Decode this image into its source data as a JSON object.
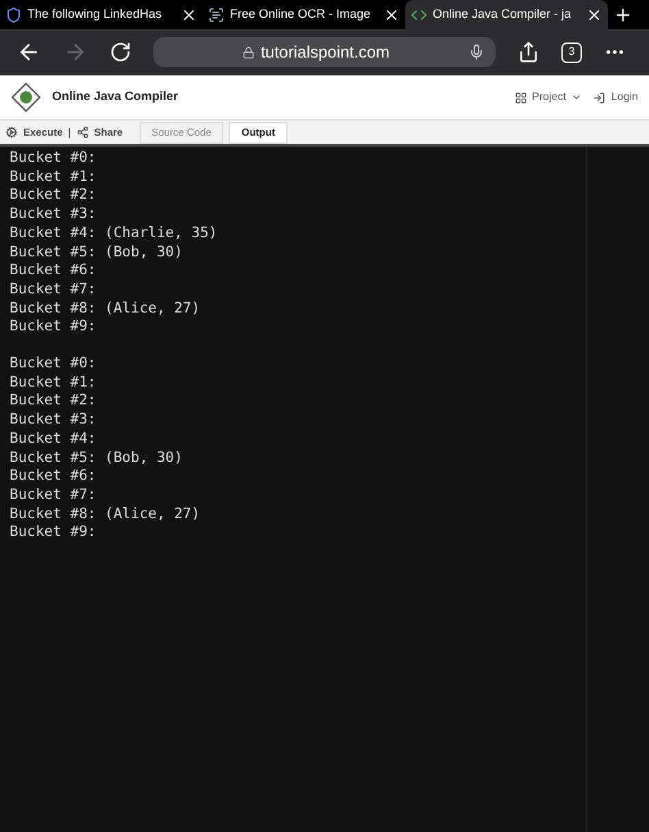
{
  "browser_tabs": [
    {
      "title": "The following LinkedHas",
      "selected": false,
      "kind": "shield"
    },
    {
      "title": "Free Online OCR - Image",
      "selected": false,
      "kind": "ocr"
    },
    {
      "title": "Online Java Compiler - ja",
      "selected": true,
      "kind": "code"
    }
  ],
  "address": "tutorialspoint.com",
  "tab_count": "3",
  "site": {
    "title": "Online Java Compiler",
    "project": "Project",
    "login": "Login"
  },
  "toolbar": {
    "execute": "Execute",
    "separator": "|",
    "share": "Share",
    "tabs": [
      {
        "label": "Source Code",
        "selected": false
      },
      {
        "label": "Output",
        "selected": true
      }
    ]
  },
  "output": [
    [
      "Bucket #0:",
      "Bucket #1:",
      "Bucket #2:",
      "Bucket #3:",
      "Bucket #4: (Charlie, 35)",
      "Bucket #5: (Bob, 30)",
      "Bucket #6:",
      "Bucket #7:",
      "Bucket #8: (Alice, 27)",
      "Bucket #9:"
    ],
    [
      "Bucket #0:",
      "Bucket #1:",
      "Bucket #2:",
      "Bucket #3:",
      "Bucket #4:",
      "Bucket #5: (Bob, 30)",
      "Bucket #6:",
      "Bucket #7:",
      "Bucket #8: (Alice, 27)",
      "Bucket #9:"
    ]
  ]
}
